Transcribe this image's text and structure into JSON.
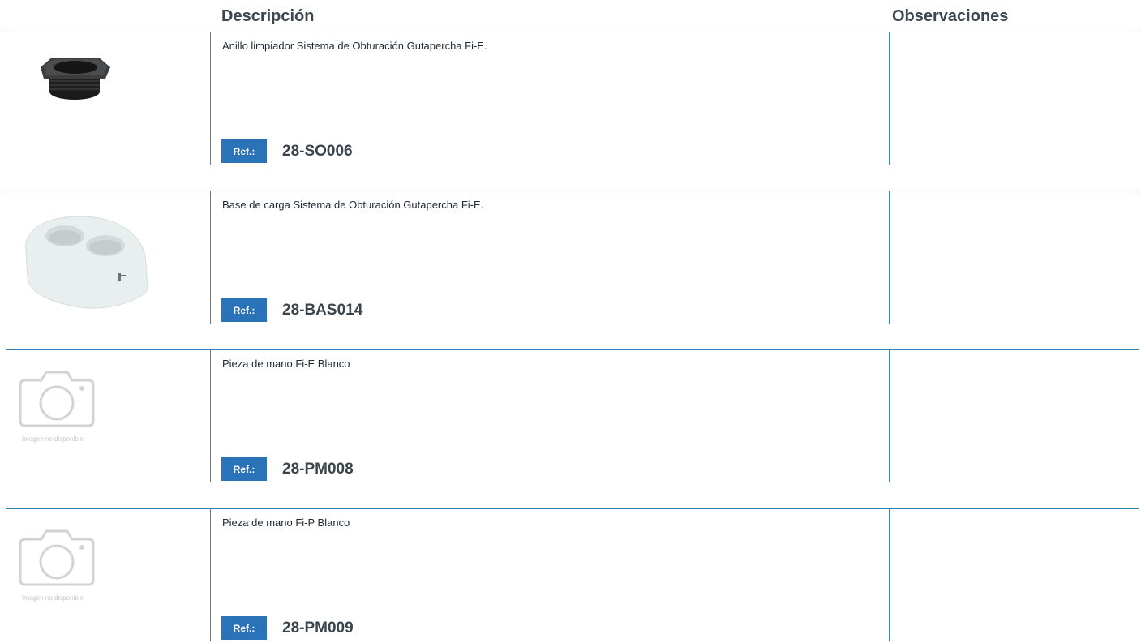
{
  "header": {
    "description": "Descripción",
    "observations": "Observaciones"
  },
  "products": [
    {
      "description": "Anillo limpiador Sistema de Obturación Gutapercha Fi-E.",
      "ref_label": "Ref.:",
      "ref_code": "28-SO006",
      "image": "black-cleaning-ring",
      "observations": ""
    },
    {
      "description": "Base de carga Sistema de Obturación Gutapercha Fi-E.",
      "ref_label": "Ref.:",
      "ref_code": "28-BAS014",
      "image": "white-charging-base",
      "observations": ""
    },
    {
      "description": "Pieza de mano Fi-E Blanco",
      "ref_label": "Ref.:",
      "ref_code": "28-PM008",
      "image": "camera-placeholder-icon",
      "image_caption": "Imagen no disponible",
      "observations": ""
    },
    {
      "description": "Pieza de mano Fi-P Blanco",
      "ref_label": "Ref.:",
      "ref_code": "28-PM009",
      "image": "camera-placeholder-icon",
      "image_caption": "Imagen no disponible",
      "observations": ""
    }
  ],
  "colors": {
    "accent": "#2a73b8",
    "divider": "#2f7fb8",
    "text": "#1f2a33"
  }
}
